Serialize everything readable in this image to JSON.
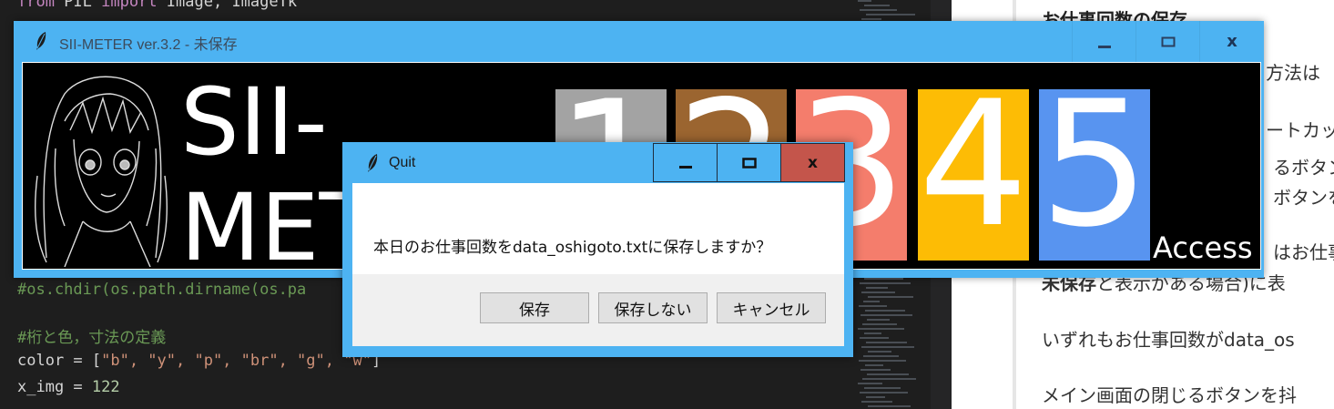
{
  "editor": {
    "lines": [
      {
        "kw": "from",
        "text": " PIL ",
        "kw2": "import",
        "rest": " Image, ImageTk"
      },
      {
        "comment": "#os.chdir(os.path.dirname(os.pa"
      },
      {
        "comment": "#桁と色，寸法の定義"
      },
      {
        "prefix": "color = [",
        "items": "\"b\", \"y\", \"p\", \"br\", \"g\", \"w\"",
        "suffix": "]"
      },
      {
        "prefix": "x_img = ",
        "num": "122"
      }
    ]
  },
  "article": {
    "heading": "お仕事回数の保存",
    "frag1": "方法は",
    "frag2": "ートカッ",
    "frag3": "るボタン",
    "frag4": "ボタンを",
    "frag5": "はお仕事",
    "frag6_bold": "未保存",
    "frag6_rest": "と表示がある場合)に表",
    "line7": "いずれもお仕事回数がdata_os",
    "line8": "メイン画面の閉じるボタンを抖"
  },
  "main_window": {
    "title": "SII-METER ver.3.2 - 未保存",
    "minimize_icon": "minimize-icon",
    "maximize_icon": "maximize-icon",
    "close_glyph": "x",
    "logo_line1": "SII-",
    "logo_line2": "MET",
    "digits": [
      {
        "label": "1",
        "color": "#a3a3a3"
      },
      {
        "label": "2",
        "color": "#9b6530"
      },
      {
        "label": "3",
        "color": "#f47d6c"
      },
      {
        "label": "4",
        "color": "#fdbc05"
      },
      {
        "label": "5",
        "color": "#5894f0"
      }
    ],
    "access_label": "Access"
  },
  "quit_dialog": {
    "title": "Quit",
    "close_glyph": "x",
    "message": "本日のお仕事回数をdata_oshigoto.txtに保存しますか？",
    "buttons": {
      "save": "保存",
      "dont_save": "保存しない",
      "cancel": "キャンセル"
    }
  },
  "colors": {
    "titlebar": "#4db3f2",
    "close_active": "#c4554b"
  }
}
